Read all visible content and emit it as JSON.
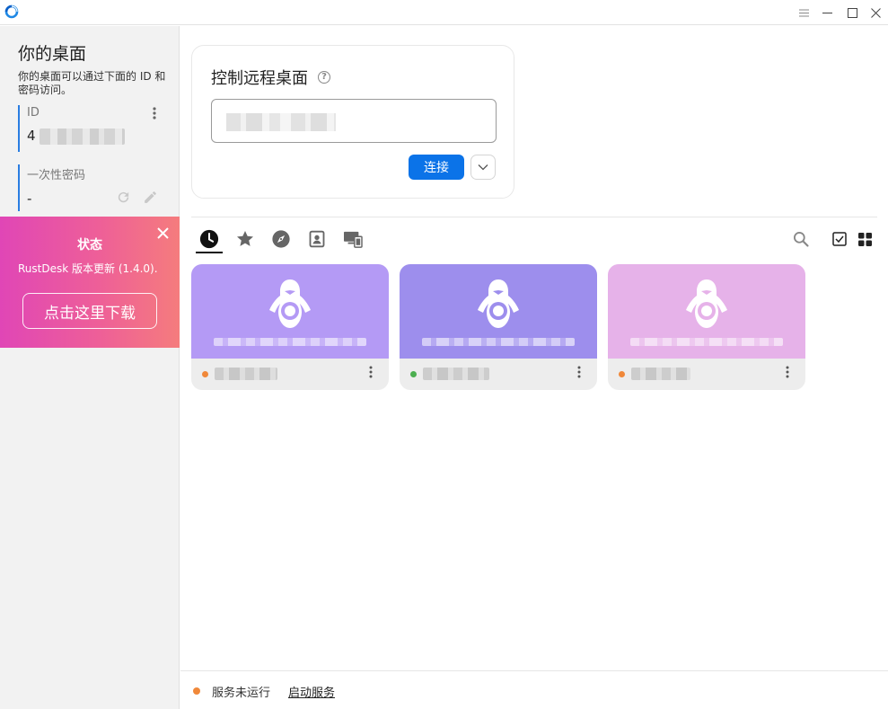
{
  "window": {
    "logo_icon": "rustdesk-logo-icon",
    "accent": "#0b73e8"
  },
  "sidebar": {
    "title": "你的桌面",
    "description": "你的桌面可以通过下面的 ID 和密码访问。",
    "id_label": "ID",
    "id_value": "4",
    "password_label": "一次性密码",
    "password_value": "-"
  },
  "banner": {
    "title": "状态",
    "message": "RustDesk 版本更新 (1.4.0).",
    "button": "点击这里下载",
    "gradient_start": "#e046b6",
    "gradient_end": "#f57c7d"
  },
  "remote": {
    "title": "控制远程桌面",
    "input_value": "",
    "connect_label": "连接"
  },
  "tabs": [
    {
      "icon": "recent-clock-icon",
      "active": true
    },
    {
      "icon": "favorites-star-icon",
      "active": false
    },
    {
      "icon": "discovered-compass-icon",
      "active": false
    },
    {
      "icon": "address-book-icon",
      "active": false
    },
    {
      "icon": "group-devices-icon",
      "active": false
    }
  ],
  "peers": [
    {
      "os": "linux",
      "color": "#b49af5",
      "status": "offline",
      "status_color": "#f0883a"
    },
    {
      "os": "linux",
      "color": "#9d8eed",
      "status": "online",
      "status_color": "#4caf50"
    },
    {
      "os": "linux",
      "color": "#e6b2e9",
      "status": "offline",
      "status_color": "#f0883a"
    }
  ],
  "status": {
    "text": "服务未运行",
    "link": "启动服务",
    "dot_color": "#f0883a"
  }
}
